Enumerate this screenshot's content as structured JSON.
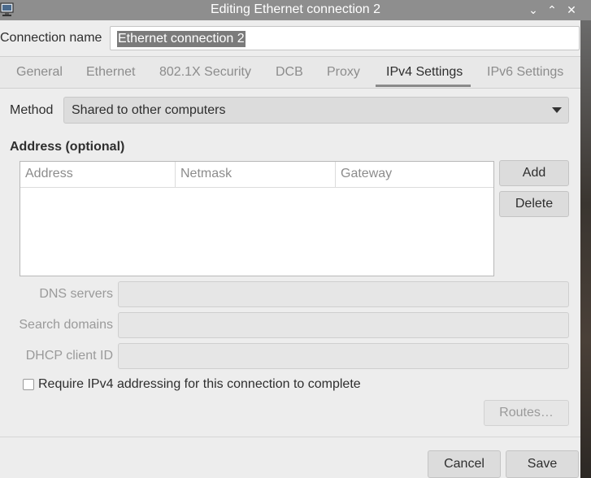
{
  "window": {
    "title": "Editing Ethernet connection 2",
    "icon": "network-computer-icon",
    "controls": {
      "minimize": "⌄",
      "maximize": "⌃",
      "close": "✕"
    }
  },
  "connection": {
    "label": "Connection name",
    "value": "Ethernet connection 2"
  },
  "tabs": [
    {
      "label": "General"
    },
    {
      "label": "Ethernet"
    },
    {
      "label": "802.1X Security"
    },
    {
      "label": "DCB"
    },
    {
      "label": "Proxy"
    },
    {
      "label": "IPv4 Settings"
    },
    {
      "label": "IPv6 Settings"
    }
  ],
  "active_tab": "IPv4 Settings",
  "method": {
    "label": "Method",
    "value": "Shared to other computers"
  },
  "address": {
    "heading": "Address (optional)",
    "columns": [
      "Address",
      "Netmask",
      "Gateway"
    ],
    "rows": [],
    "add_label": "Add",
    "delete_label": "Delete"
  },
  "fields": {
    "dns_label": "DNS servers",
    "dns_value": "",
    "search_label": "Search domains",
    "search_value": "",
    "dhcp_label": "DHCP client ID",
    "dhcp_value": ""
  },
  "require_ipv4": {
    "label": "Require IPv4 addressing for this connection to complete",
    "checked": false
  },
  "routes_label": "Routes…",
  "footer": {
    "cancel_label": "Cancel",
    "save_label": "Save"
  }
}
